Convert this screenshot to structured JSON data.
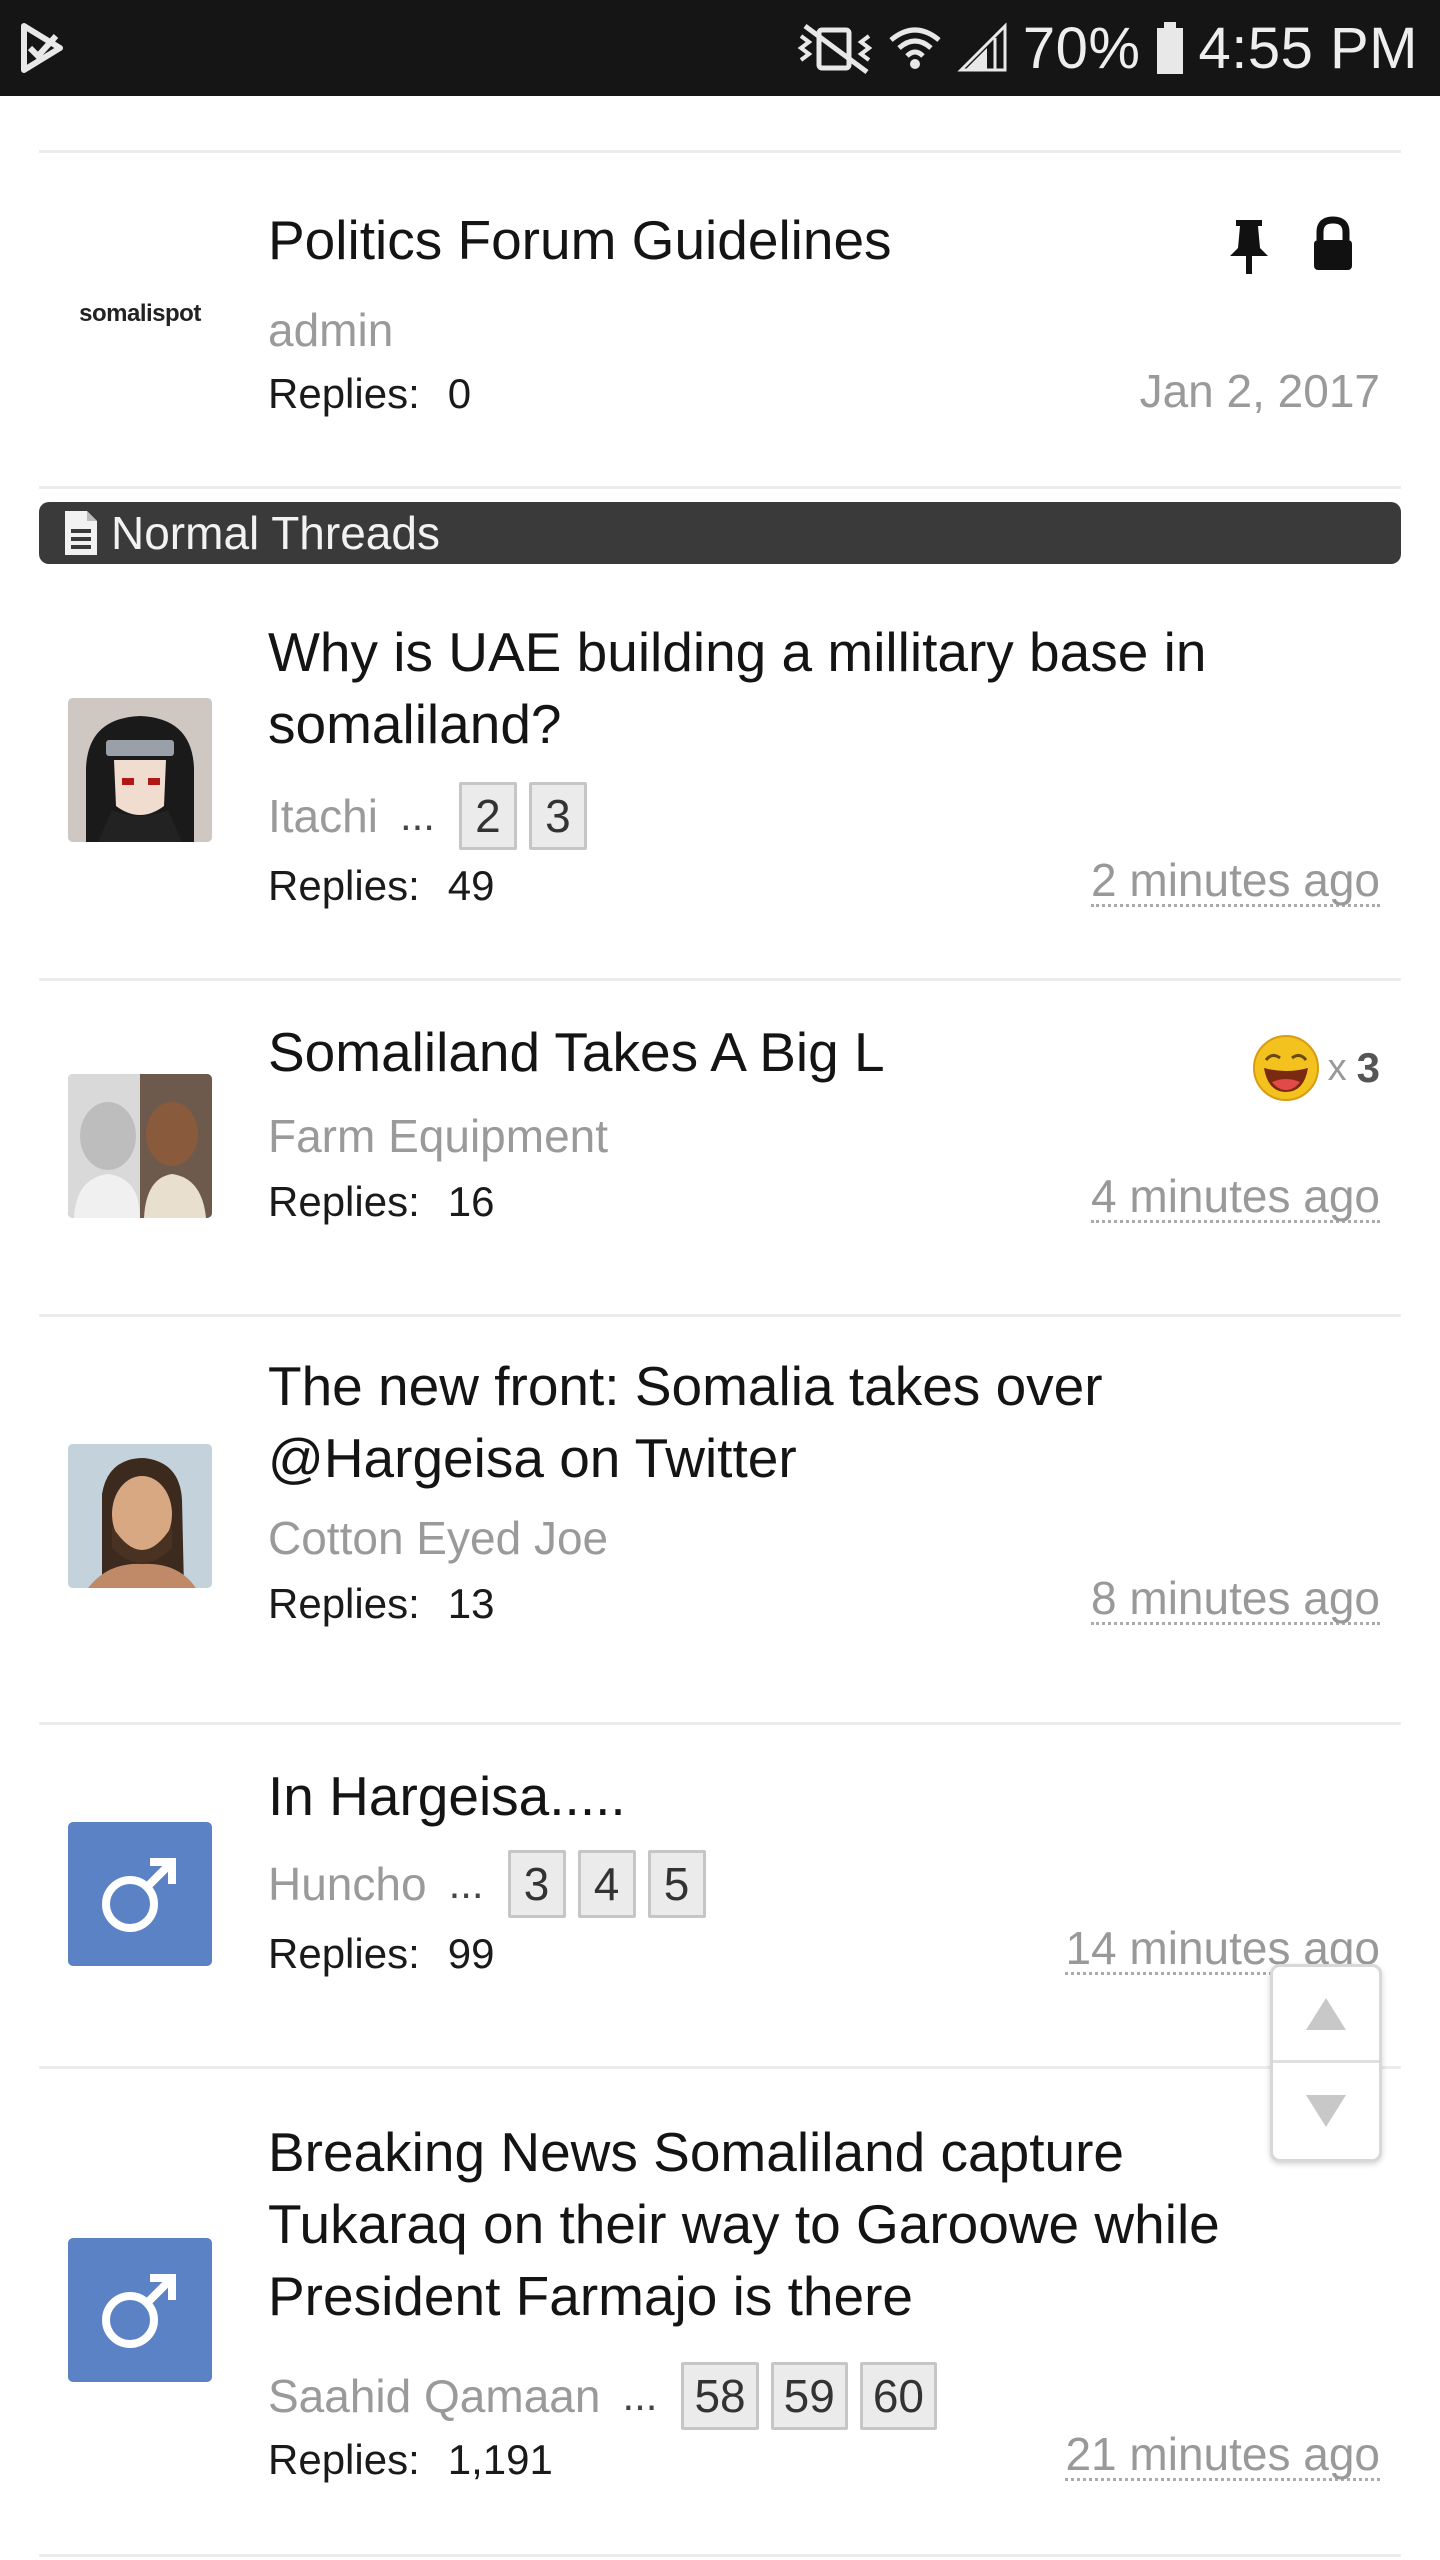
{
  "status_bar": {
    "battery": "70%",
    "time": "4:55 PM",
    "icons": [
      "notification-check-icon",
      "mute-vibrate-icon",
      "wifi-icon",
      "signal-icon",
      "battery-icon"
    ]
  },
  "sticky": {
    "title": "Politics Forum Guidelines",
    "author": "admin",
    "logo_text": "somalispot",
    "replies_label": "Replies:",
    "replies": "0",
    "date": "Jan 2, 2017",
    "icons": [
      "pin-icon",
      "lock-icon"
    ]
  },
  "section": {
    "label": "Normal Threads"
  },
  "threads": [
    {
      "title": "Why is UAE building a millitary base in somaliland?",
      "author": "Itachi",
      "dots": "...",
      "pages": [
        "2",
        "3"
      ],
      "replies_label": "Replies:",
      "replies": "49",
      "time": "2 minutes ago"
    },
    {
      "title": "Somaliland Takes A Big L",
      "author": "Farm Equipment",
      "replies_label": "Replies:",
      "replies": "16",
      "time": "4 minutes ago",
      "rating": {
        "x": "x",
        "count": "3"
      }
    },
    {
      "title": "The new front: Somalia takes over @Hargeisa on Twitter",
      "author": "Cotton Eyed Joe",
      "replies_label": "Replies:",
      "replies": "13",
      "time": "8 minutes ago"
    },
    {
      "title": "In Hargeisa.....",
      "author": "Huncho",
      "dots": "...",
      "pages": [
        "3",
        "4",
        "5"
      ],
      "replies_label": "Replies:",
      "replies": "99",
      "time": "14 minutes ago"
    },
    {
      "title": "Breaking News Somaliland capture Tukaraq on their way to Garoowe while President Farmajo is there",
      "author": "Saahid Qamaan",
      "dots": "...",
      "pages": [
        "58",
        "59",
        "60"
      ],
      "replies_label": "Replies:",
      "replies": "1,191",
      "time": "21 minutes ago"
    }
  ],
  "colors": {
    "status_bar_bg": "#151515",
    "section_header_bg": "#3a3a3a",
    "male_avatar_bg": "#5b82c4",
    "muted_text": "#9a9a9a"
  }
}
